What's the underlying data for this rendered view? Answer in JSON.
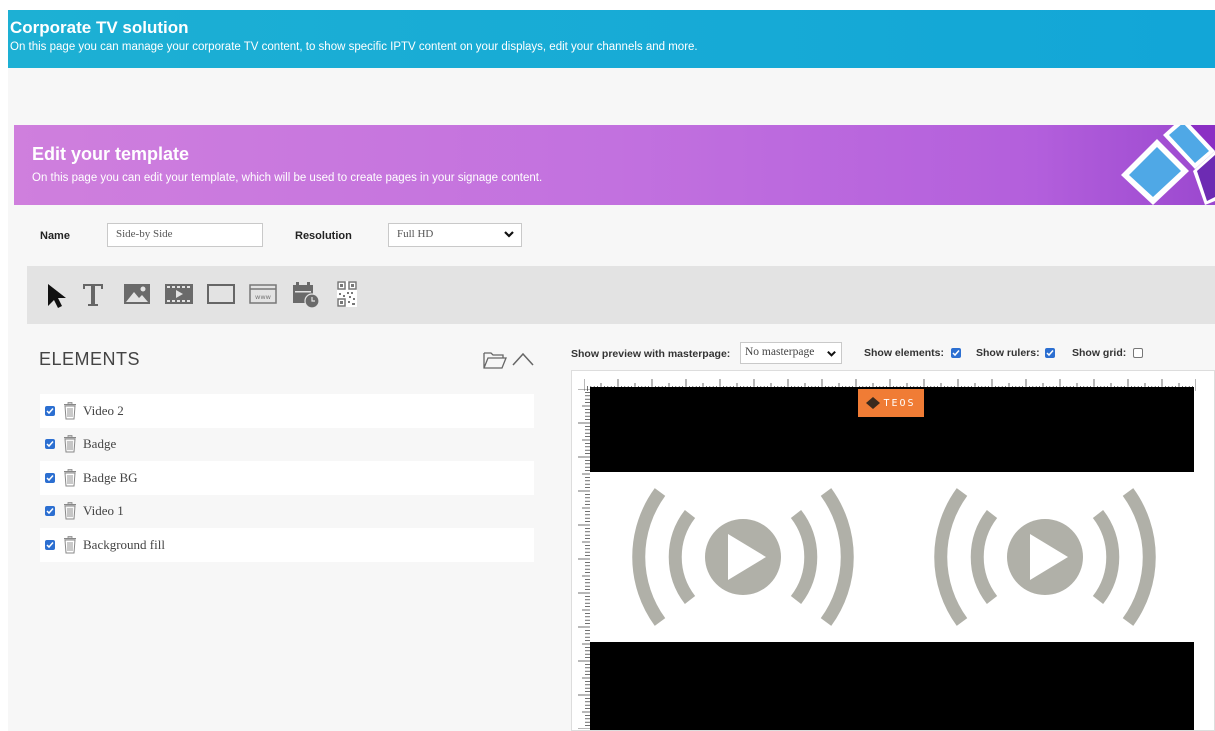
{
  "header": {
    "title": "Corporate TV solution",
    "subtitle": "On this page you can manage your corporate TV content, to show specific IPTV content on your displays, edit your channels and more."
  },
  "template_banner": {
    "title": "Edit your template",
    "subtitle": "On this page you can edit your template, which will be used to create pages in your signage content."
  },
  "form": {
    "name_label": "Name",
    "name_value": "Side-by Side",
    "resolution_label": "Resolution",
    "resolution_value": "Full HD"
  },
  "toolbar": {
    "tools": [
      "pointer-icon",
      "text-icon",
      "image-icon",
      "video-icon",
      "rectangle-icon",
      "web-icon",
      "calendar-clock-icon",
      "qr-code-icon"
    ]
  },
  "elements": {
    "title": "ELEMENTS",
    "items": [
      {
        "label": "Video 2",
        "checked": true
      },
      {
        "label": "Badge",
        "checked": true
      },
      {
        "label": "Badge BG",
        "checked": true
      },
      {
        "label": "Video 1",
        "checked": true
      },
      {
        "label": "Background fill",
        "checked": true
      }
    ]
  },
  "preview_options": {
    "masterpage_label": "Show preview with masterpage:",
    "masterpage_value": "No masterpage",
    "show_elements_label": "Show elements:",
    "show_elements": true,
    "show_rulers_label": "Show rulers:",
    "show_rulers": true,
    "show_grid_label": "Show grid:",
    "show_grid": false
  },
  "canvas": {
    "badge_text": "TEOS"
  },
  "colors": {
    "header_bg": "#16a9d5",
    "template_banner_bg": "#c271df",
    "checkbox": "#2c6fd1",
    "badge_bg": "#f07c35",
    "video_placeholder": "#b0b0a8"
  }
}
